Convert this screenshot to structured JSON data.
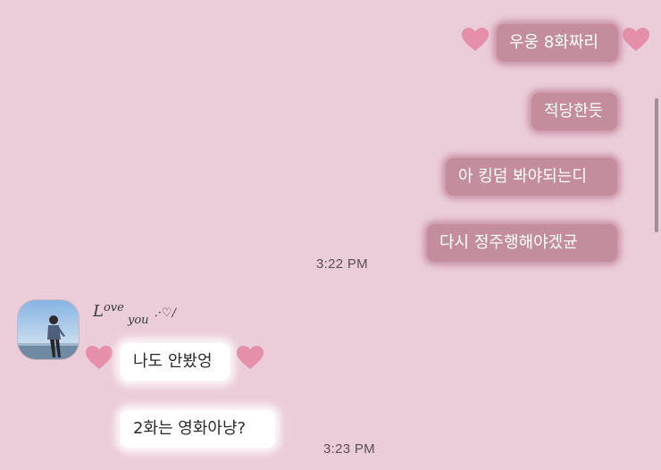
{
  "messages_out": [
    {
      "text": "우웅 8화짜리"
    },
    {
      "text": "적당한듯"
    },
    {
      "text": "아 킹덤 봐야되는디"
    },
    {
      "text": "다시 정주행해야겠균"
    }
  ],
  "timestamps": [
    "3:22 PM",
    "3:23 PM"
  ],
  "contact": {
    "name_script": "Love you",
    "name_first": "L",
    "name_rest": "ove",
    "name_you": "you",
    "name_tail": ".·♡/"
  },
  "messages_in": [
    {
      "text": "나도 안봤엉"
    },
    {
      "text": "2화는 영화아냥?"
    }
  ],
  "colors": {
    "background": "#ebccd9",
    "outgoing_bubble": "#c48d9e",
    "incoming_bubble": "#ffffff",
    "heart": "#e58fab"
  },
  "icons": [
    "heart-icon",
    "profile-avatar-photo"
  ]
}
